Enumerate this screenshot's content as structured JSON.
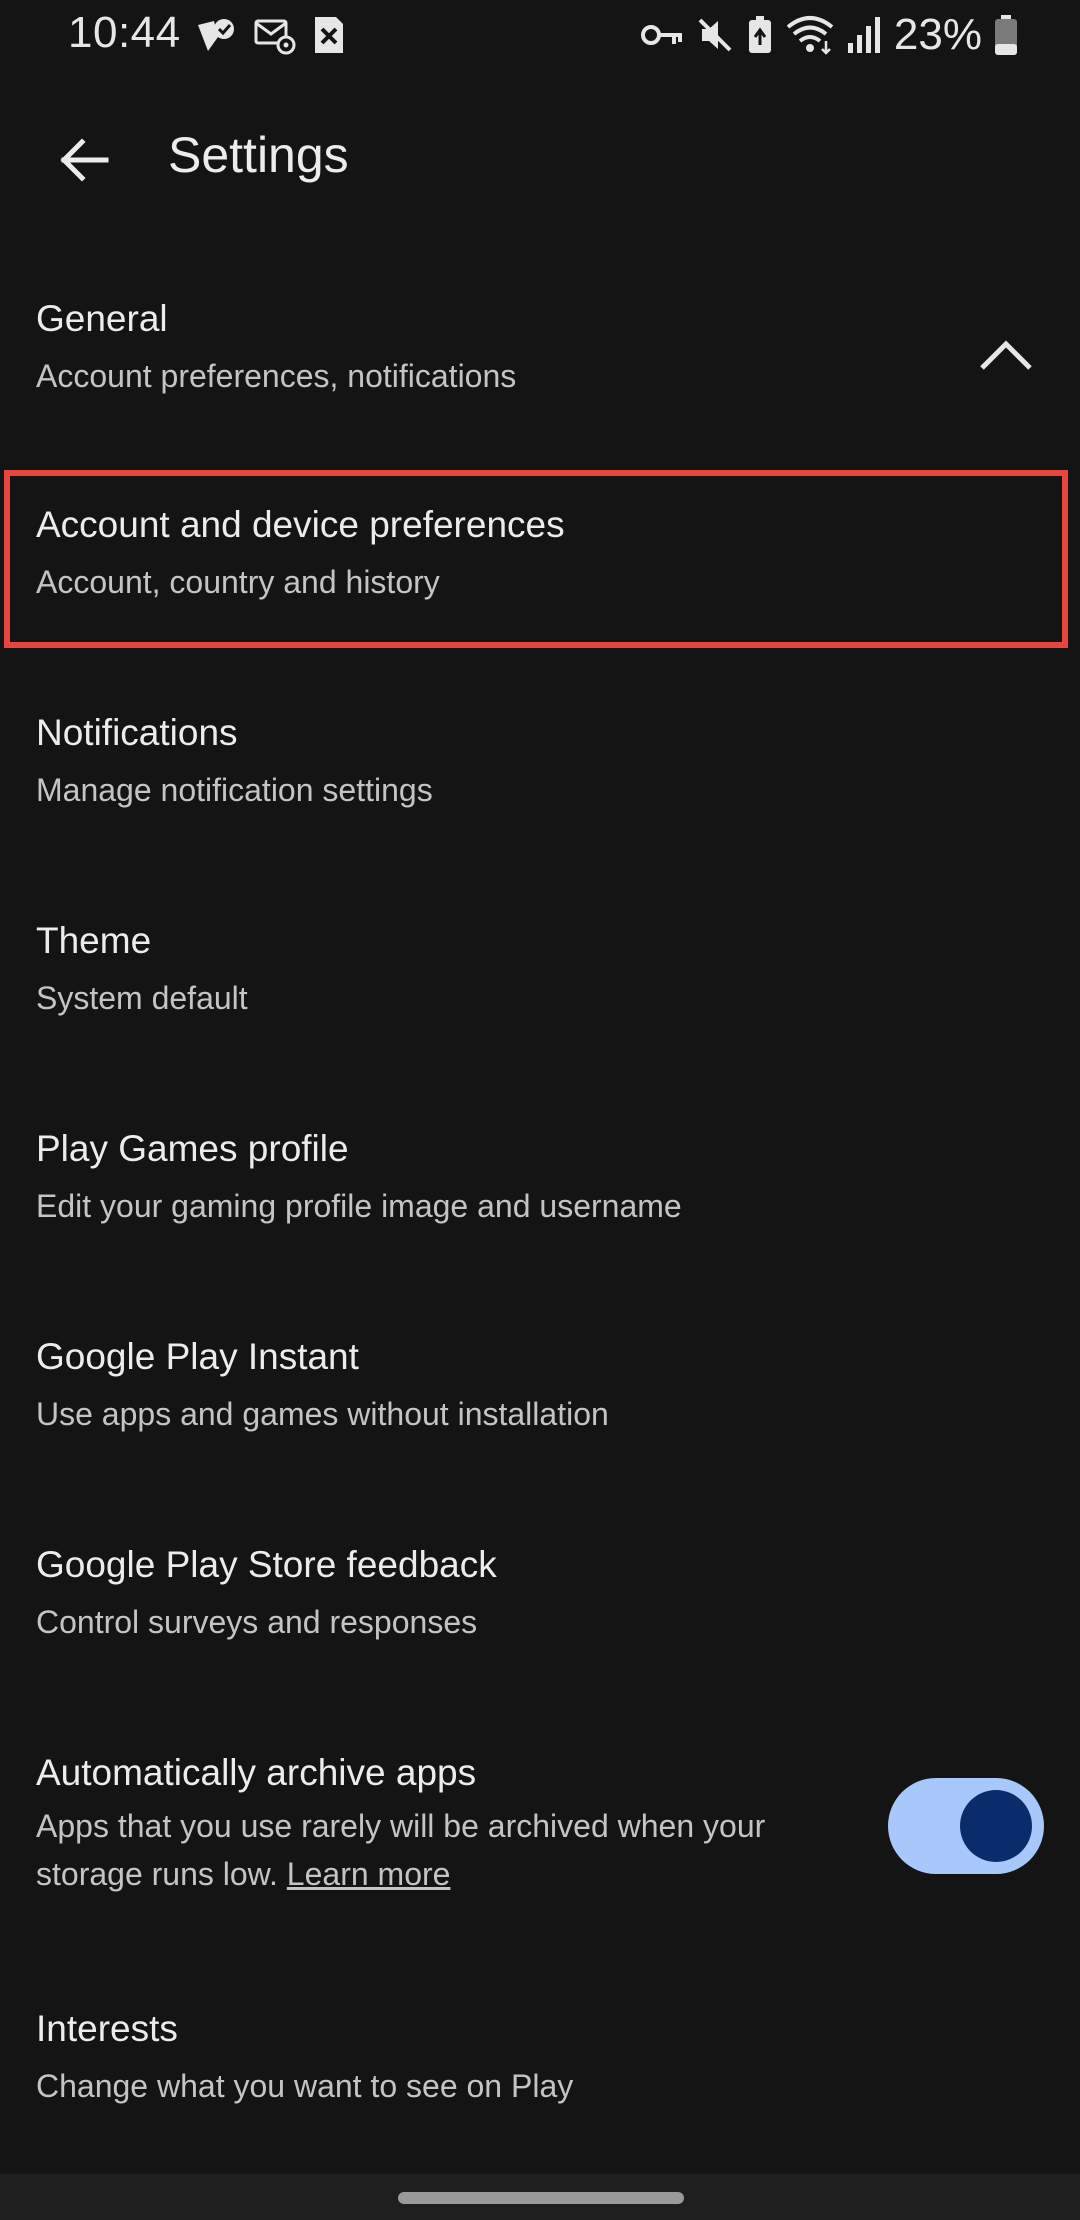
{
  "status_bar": {
    "time": "10:44",
    "battery_percent": "23%",
    "left_icons": [
      "delivery-check-icon",
      "email-settings-icon",
      "close-box-icon"
    ],
    "right_icons": [
      "vpn-key-icon",
      "mute-icon",
      "battery-saver-icon",
      "wifi-icon",
      "cell-signal-icon",
      "battery-icon"
    ]
  },
  "app_bar": {
    "title": "Settings",
    "back_icon": "arrow-back-icon"
  },
  "settings": {
    "general": {
      "title": "General",
      "subtitle": "Account preferences, notifications",
      "expanded": true
    },
    "items": [
      {
        "title": "Account and device preferences",
        "subtitle": "Account, country and history",
        "highlighted": true
      },
      {
        "title": "Notifications",
        "subtitle": "Manage notification settings"
      },
      {
        "title": "Theme",
        "subtitle": "System default"
      },
      {
        "title": "Play Games profile",
        "subtitle": "Edit your gaming profile image and username"
      },
      {
        "title": "Google Play Instant",
        "subtitle": "Use apps and games without installation"
      },
      {
        "title": "Google Play Store feedback",
        "subtitle": "Control surveys and responses"
      }
    ],
    "auto_archive": {
      "title": "Automatically archive apps",
      "subtitle": "Apps that you use rarely will be archived when your storage runs low.",
      "link_text": "Learn more",
      "toggle_on": true
    },
    "interests": {
      "title": "Interests",
      "subtitle": "Change what you want to see on Play"
    }
  },
  "colors": {
    "background": "#141414",
    "highlight_border": "#e8453c",
    "toggle_track": "#a8c7fa",
    "toggle_knob": "#0b2c6b"
  }
}
